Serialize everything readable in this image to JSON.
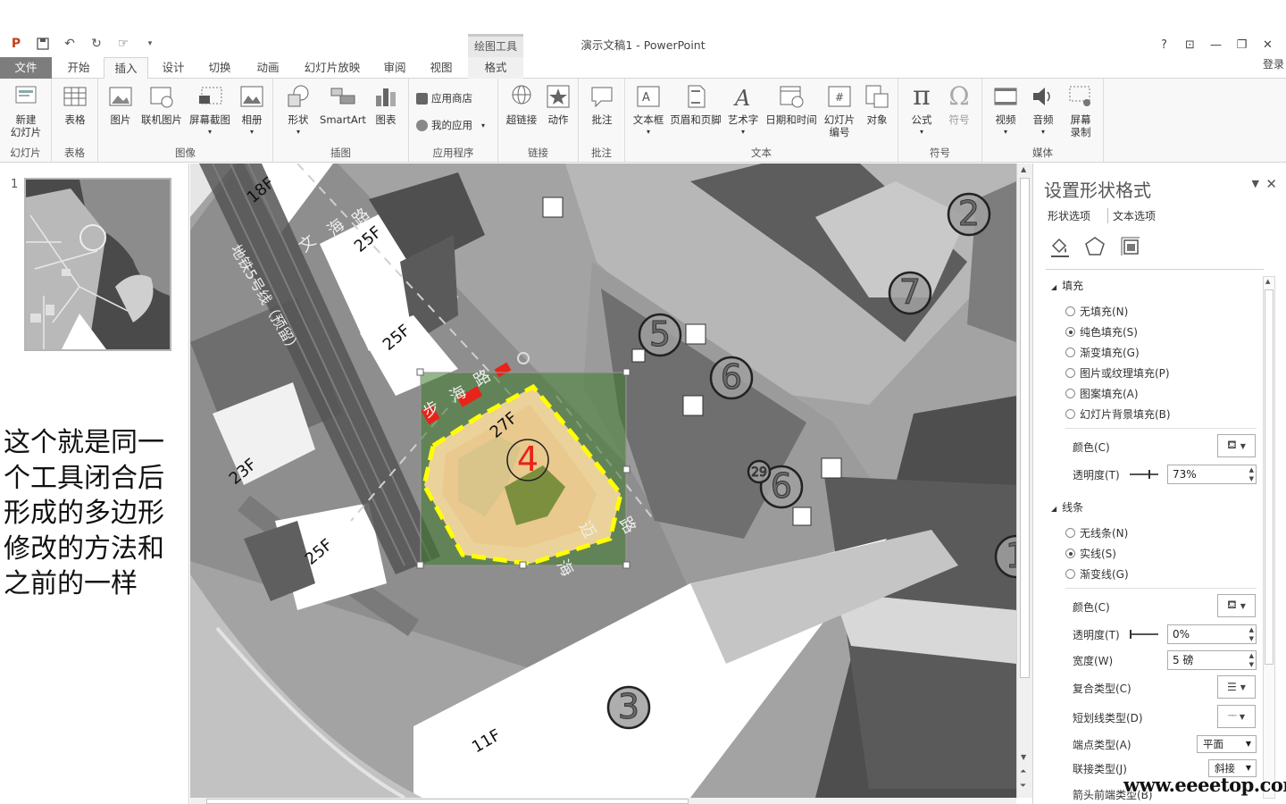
{
  "titlebar": {
    "context_tool": "绘图工具",
    "doc_title": "演示文稿1 - PowerPoint",
    "help": "?",
    "restore_ribbon": "⊡",
    "minimize": "—",
    "maximize": "❐",
    "close": "✕"
  },
  "tabs": [
    "文件",
    "开始",
    "插入",
    "设计",
    "切换",
    "动画",
    "幻灯片放映",
    "审阅",
    "视图",
    "格式"
  ],
  "login": "登录",
  "ribbon": {
    "groups": {
      "slides": "幻灯片",
      "tables": "表格",
      "images": "图像",
      "illustrations": "插图",
      "apps": "应用程序",
      "links": "链接",
      "comments": "批注",
      "text": "文本",
      "symbols": "符号",
      "media": "媒体"
    },
    "buttons": {
      "new_slide_1": "新建",
      "new_slide_2": "幻灯片",
      "table": "表格",
      "picture": "图片",
      "online_picture": "联机图片",
      "screenshot": "屏幕截图",
      "album": "相册",
      "shapes": "形状",
      "smartart": "SmartArt",
      "chart": "图表",
      "store": "应用商店",
      "my_apps": "我的应用",
      "hyperlink": "超链接",
      "action": "动作",
      "comment": "批注",
      "textbox": "文本框",
      "header_footer": "页眉和页脚",
      "wordart": "艺术字",
      "datetime": "日期和时间",
      "slide_num_1": "幻灯片",
      "slide_num_2": "编号",
      "object": "对象",
      "equation": "公式",
      "symbol": "符号",
      "video": "视频",
      "audio": "音频",
      "screen_rec_1": "屏幕",
      "screen_rec_2": "录制"
    }
  },
  "thumbnails": {
    "slide_number": "1"
  },
  "note_text": "这个就是同一个工具闭合后形成的多边形修改的方法和之前的一样",
  "canvas": {
    "building_labels": [
      "18F",
      "25F",
      "25F",
      "23F",
      "25F",
      "27F",
      "11F"
    ],
    "road_labels": [
      "文",
      "海",
      "路",
      "地铁5号线（预留）",
      "步",
      "海",
      "路",
      "海",
      "迈",
      "路"
    ],
    "markers": [
      "2",
      "7",
      "5",
      "6",
      "6",
      "1",
      "3",
      "4",
      "29",
      "29"
    ]
  },
  "format_pane": {
    "title": "设置形状格式",
    "tabs": [
      "形状选项",
      "文本选项"
    ],
    "fill": {
      "header": "填充",
      "options": [
        "无填充(N)",
        "纯色填充(S)",
        "渐变填充(G)",
        "图片或纹理填充(P)",
        "图案填充(A)",
        "幻灯片背景填充(B)"
      ],
      "selected": 1,
      "color_label": "颜色(C)",
      "transparency_label": "透明度(T)",
      "transparency_value": "73%"
    },
    "line": {
      "header": "线条",
      "options": [
        "无线条(N)",
        "实线(S)",
        "渐变线(G)"
      ],
      "selected": 1,
      "color_label": "颜色(C)",
      "transparency_label": "透明度(T)",
      "transparency_value": "0%",
      "width_label": "宽度(W)",
      "width_value": "5 磅",
      "compound_label": "复合类型(C)",
      "dash_label": "短划线类型(D)",
      "cap_label": "端点类型(A)",
      "cap_value": "平面",
      "join_label": "联接类型(J)",
      "join_value": "斜接",
      "arrow_begin_label": "箭头前端类型(B)"
    }
  },
  "watermark": "www.eeeetop.com",
  "colors": {
    "file_tab": "#7d7d7d",
    "selection_fill": "#f5d9a0",
    "selection_line": "#ffff00",
    "marker_red": "#e8231a"
  }
}
